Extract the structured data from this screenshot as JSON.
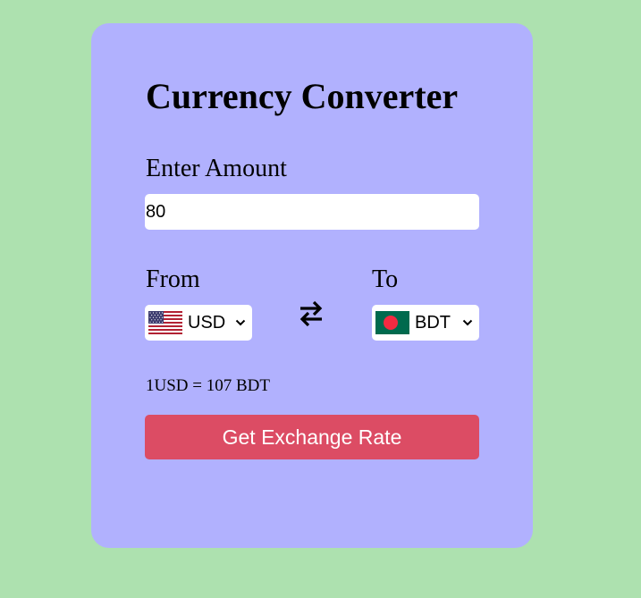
{
  "converter": {
    "title": "Currency Converter",
    "amount_label": "Enter Amount",
    "amount_value": "80",
    "from_label": "From",
    "to_label": "To",
    "from": {
      "code": "USD",
      "flag_icon": "us-flag-icon"
    },
    "to": {
      "code": "BDT",
      "flag_icon": "bd-flag-icon"
    },
    "swap_icon": "swap-arrows-icon",
    "rate_text": "1USD = 107 BDT",
    "button_label": "Get Exchange Rate"
  },
  "colors": {
    "page_background": "#ade1af",
    "card_background": "#b1b1fe",
    "button_background": "#dc4c64",
    "button_text": "#ffffff"
  }
}
